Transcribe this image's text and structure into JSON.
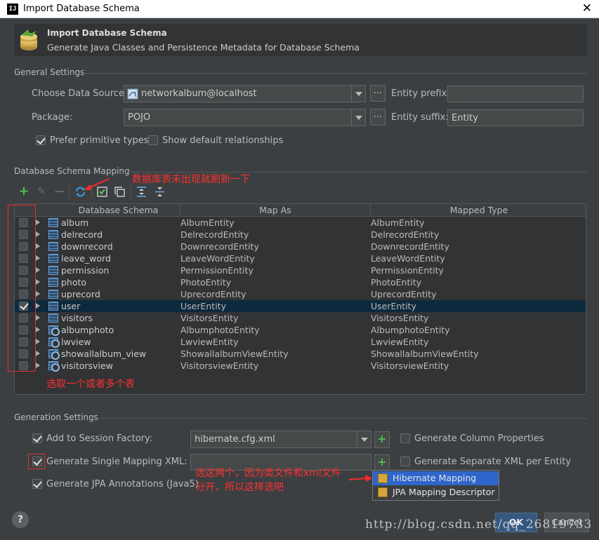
{
  "window": {
    "title": "Import Database Schema",
    "app_icon": "IJ",
    "close_glyph": "✕"
  },
  "banner": {
    "title": "Import Database Schema",
    "subtitle": "Generate Java Classes and Persistence Metadata for Database Schema"
  },
  "general": {
    "section_title": "General Settings",
    "datasource_label": "Choose Data Source:",
    "datasource_value": "networkalbum@localhost",
    "package_label": "Package:",
    "package_value": "POJO",
    "dots": "...",
    "entity_prefix_label": "Entity prefix:",
    "entity_prefix_value": "",
    "entity_suffix_label": "Entity suffix:",
    "entity_suffix_value": "Entity",
    "prefer_primitive_label": "Prefer primitive types",
    "prefer_primitive_checked": true,
    "show_default_rel_label": "Show default relationships",
    "show_default_rel_checked": false
  },
  "mapping": {
    "section_title": "Database Schema Mapping",
    "columns": [
      "Database Schema",
      "Map As",
      "Mapped Type"
    ],
    "rows": [
      {
        "name": "album",
        "map_as": "AlbumEntity",
        "type": "AlbumEntity",
        "checked": false,
        "view": false
      },
      {
        "name": "delrecord",
        "map_as": "DelrecordEntity",
        "type": "DelrecordEntity",
        "checked": false,
        "view": false
      },
      {
        "name": "downrecord",
        "map_as": "DownrecordEntity",
        "type": "DownrecordEntity",
        "checked": false,
        "view": false
      },
      {
        "name": "leave_word",
        "map_as": "LeaveWordEntity",
        "type": "LeaveWordEntity",
        "checked": false,
        "view": false
      },
      {
        "name": "permission",
        "map_as": "PermissionEntity",
        "type": "PermissionEntity",
        "checked": false,
        "view": false
      },
      {
        "name": "photo",
        "map_as": "PhotoEntity",
        "type": "PhotoEntity",
        "checked": false,
        "view": false
      },
      {
        "name": "uprecord",
        "map_as": "UprecordEntity",
        "type": "UprecordEntity",
        "checked": false,
        "view": false
      },
      {
        "name": "user",
        "map_as": "UserEntity",
        "type": "UserEntity",
        "checked": true,
        "view": false
      },
      {
        "name": "visitors",
        "map_as": "VisitorsEntity",
        "type": "VisitorsEntity",
        "checked": false,
        "view": false
      },
      {
        "name": "albumphoto",
        "map_as": "AlbumphotoEntity",
        "type": "AlbumphotoEntity",
        "checked": false,
        "view": true
      },
      {
        "name": "lwview",
        "map_as": "LwviewEntity",
        "type": "LwviewEntity",
        "checked": false,
        "view": true
      },
      {
        "name": "showallalbum_view",
        "map_as": "ShowallalbumViewEntity",
        "type": "ShowallalbumViewEntity",
        "checked": false,
        "view": true
      },
      {
        "name": "visitorsview",
        "map_as": "VisitorsviewEntity",
        "type": "VisitorsviewEntity",
        "checked": false,
        "view": true
      }
    ]
  },
  "annotations": {
    "refresh_note": "数据库表未出现就刷新一下",
    "select_note": "选取一个或者多个表",
    "choose_note_line1": "选这两个，因为类文件和xml文件",
    "choose_note_line2": "分开，所以这样选吧"
  },
  "generation": {
    "section_title": "Generation Settings",
    "session_factory_label": "Add to Session Factory:",
    "session_factory_checked": true,
    "session_factory_value": "hibernate.cfg.xml",
    "single_mapping_label": "Generate Single Mapping XML:",
    "single_mapping_checked": true,
    "single_mapping_value": "",
    "jpa_label": "Generate JPA Annotations (Java5)",
    "jpa_checked": true,
    "gen_column_props_label": "Generate Column Properties",
    "gen_column_props_checked": false,
    "gen_separate_xml_label": "Generate Separate XML per Entity",
    "gen_separate_xml_checked": false,
    "plus": "+"
  },
  "popup": {
    "items": [
      "Hibernate Mapping",
      "JPA Mapping Descriptor"
    ],
    "selected_index": 0
  },
  "footer": {
    "help": "?",
    "ok_label": "OK",
    "cancel_label": "Cancel",
    "watermark": "http://blog.csdn.net/qq_26819733"
  },
  "colors": {
    "background": "#3c3f41",
    "selection": "#0d293e",
    "annotation_red": "#ff3030",
    "popup_selection": "#2f65ca",
    "ok_button": "#365880"
  }
}
